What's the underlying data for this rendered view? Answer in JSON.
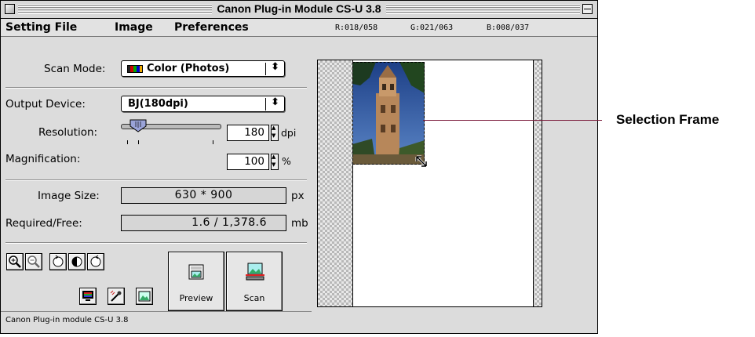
{
  "window": {
    "title": "Canon Plug-in Module CS-U 3.8"
  },
  "menu": {
    "items": [
      "Setting File",
      "Image",
      "Preferences"
    ]
  },
  "readout_rgb": {
    "r": "R:018/058",
    "g": "G:021/063",
    "b": "B:008/037"
  },
  "scan_mode": {
    "label": "Scan Mode:",
    "value": "Color (Photos)"
  },
  "output_device": {
    "label": "Output Device:",
    "value": "BJ(180dpi)"
  },
  "resolution": {
    "label": "Resolution:",
    "value": "180",
    "unit": "dpi"
  },
  "magnification": {
    "label": "Magnification:",
    "value": "100",
    "unit": "%"
  },
  "image_size": {
    "label": "Image Size:",
    "value": "630 * 900",
    "unit": "px"
  },
  "required_free": {
    "label": "Required/Free:",
    "value": "1.6 / 1,378.6",
    "unit": "mb"
  },
  "buttons": {
    "preview": "Preview",
    "scan": "Scan"
  },
  "status": "Canon Plug-in module CS-U 3.8",
  "annotation": "Selection Frame",
  "icons": [
    "zoom-in-icon",
    "zoom-out-icon",
    "rotate-left-icon",
    "mirror-icon",
    "rotate-right-icon",
    "monitor-icon",
    "eyedropper-icon",
    "image-adjust-icon",
    "preview-icon",
    "scan-icon",
    "popup-arrows-icon",
    "resize-handle-icon"
  ]
}
